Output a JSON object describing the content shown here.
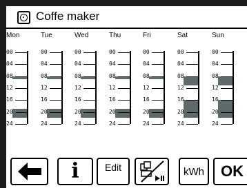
{
  "app": {
    "title": "Coffe maker",
    "icon": "socket-icon"
  },
  "schedule": {
    "days": [
      {
        "name": "Mon",
        "on_hours": [
          [
            8,
            9
          ],
          [
            19,
            22
          ]
        ]
      },
      {
        "name": "Tue",
        "on_hours": [
          [
            8,
            9
          ],
          [
            19,
            22
          ]
        ]
      },
      {
        "name": "Wed",
        "on_hours": [
          [
            8,
            9
          ],
          [
            19,
            22
          ]
        ]
      },
      {
        "name": "Thu",
        "on_hours": [
          [
            8,
            9
          ],
          [
            19,
            22
          ]
        ]
      },
      {
        "name": "Fri",
        "on_hours": [
          [
            8,
            9
          ],
          [
            19,
            22
          ]
        ]
      },
      {
        "name": "Sat",
        "on_hours": [
          [
            8,
            11
          ],
          [
            16,
            22
          ]
        ]
      },
      {
        "name": "Sun",
        "on_hours": [
          [
            8,
            11
          ],
          [
            16,
            22
          ]
        ]
      }
    ],
    "hour_labels": [
      "00",
      "04",
      "08",
      "12",
      "16",
      "20",
      "24"
    ]
  },
  "toolbar": {
    "back_icon": "arrow-left-icon",
    "info_label": "i",
    "edit_label": "Edit",
    "manual_icon": "manual-switch-icon",
    "kwh_label": "kWh",
    "ok_label": "OK"
  },
  "colors": {
    "bar": "#5e6a6a",
    "frame": "#1a1a1a"
  }
}
